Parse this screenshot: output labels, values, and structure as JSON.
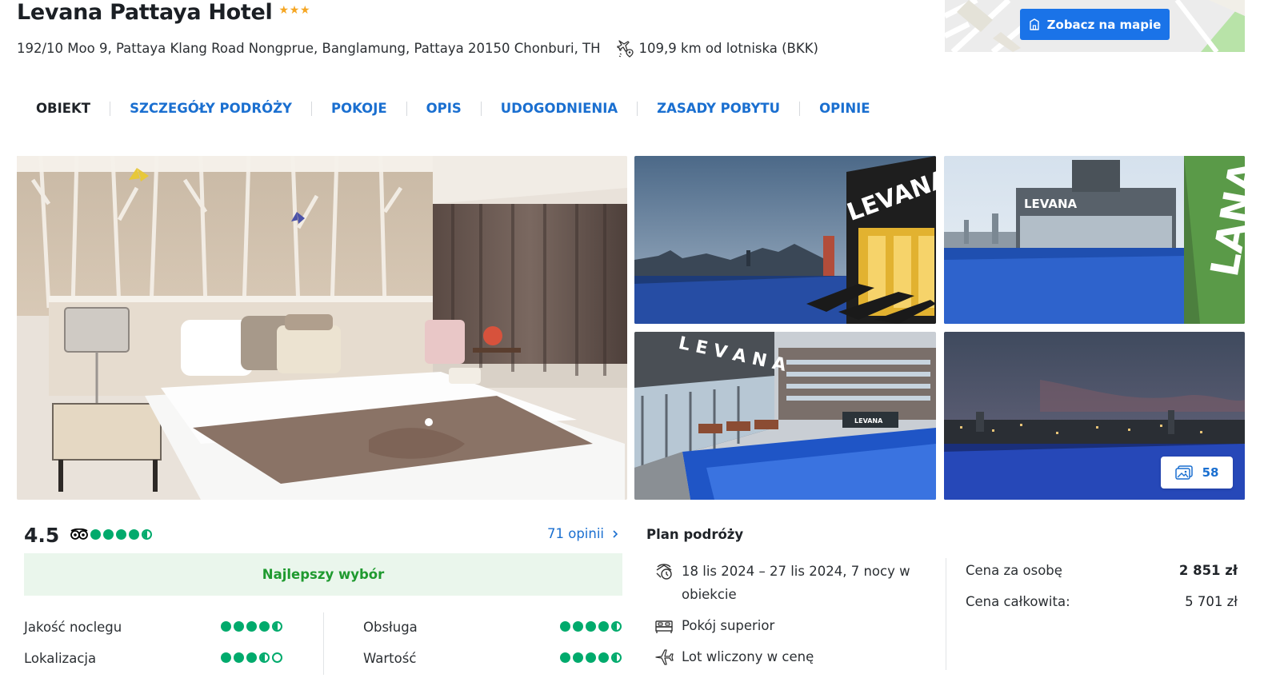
{
  "hotel": {
    "name": "Levana Pattaya Hotel",
    "stars": 3,
    "address": "192/10 Moo 9, Pattaya Klang Road Nongprue, Banglamung, Pattaya 20150 Chonburi, TH",
    "airport_distance": "109,9 km od lotniska (BKK)"
  },
  "map": {
    "button_label": "Zobacz na mapie"
  },
  "tabs": [
    {
      "label": "OBIEKT",
      "active": true
    },
    {
      "label": "SZCZEGÓŁY PODRÓŻY"
    },
    {
      "label": "POKOJE"
    },
    {
      "label": "OPIS"
    },
    {
      "label": "UDOGODNIENIA"
    },
    {
      "label": "ZASADY POBYTU"
    },
    {
      "label": "OPINIE"
    }
  ],
  "gallery": {
    "photo_count": "58",
    "logo_text": "LEVANA"
  },
  "rating": {
    "score": "4.5",
    "reviews_link": "71 opinii",
    "badge": "Najlepszy wybór",
    "categories": [
      {
        "label": "Jakość noclegu",
        "value": 4.5
      },
      {
        "label": "Obsługa",
        "value": 4.5
      },
      {
        "label": "Lokalizacja",
        "value": 3.5
      },
      {
        "label": "Wartość",
        "value": 4.5
      }
    ]
  },
  "plan": {
    "title": "Plan podróży",
    "dates_line1": "18 lis 2024 – 27 lis 2024, 7 nocy w",
    "dates_line2": "obiekcie",
    "room": "Pokój superior",
    "flight": "Lot wliczony w cenę"
  },
  "prices": {
    "per_person_label": "Cena za osobę",
    "per_person_value": "2 851 zł",
    "total_label": "Cena całkowita:",
    "total_value": "5 701 zł"
  },
  "colors": {
    "accent": "#1a73e8",
    "link": "#1a6fd0",
    "tripadvisor_green": "#00aa6c",
    "badge_bg": "#eaf6ec",
    "badge_text": "#1f9a2f",
    "star": "#f5a623"
  },
  "icons": {
    "stars": "star-icon",
    "airport": "plane-distance-icon",
    "map_button": "building-icon",
    "photos": "images-icon",
    "tripadvisor": "tripadvisor-owl-icon",
    "chevron": "chevron-right-icon",
    "dates": "calendar-clock-icon",
    "room": "bed-icon",
    "flight": "airplane-icon"
  }
}
